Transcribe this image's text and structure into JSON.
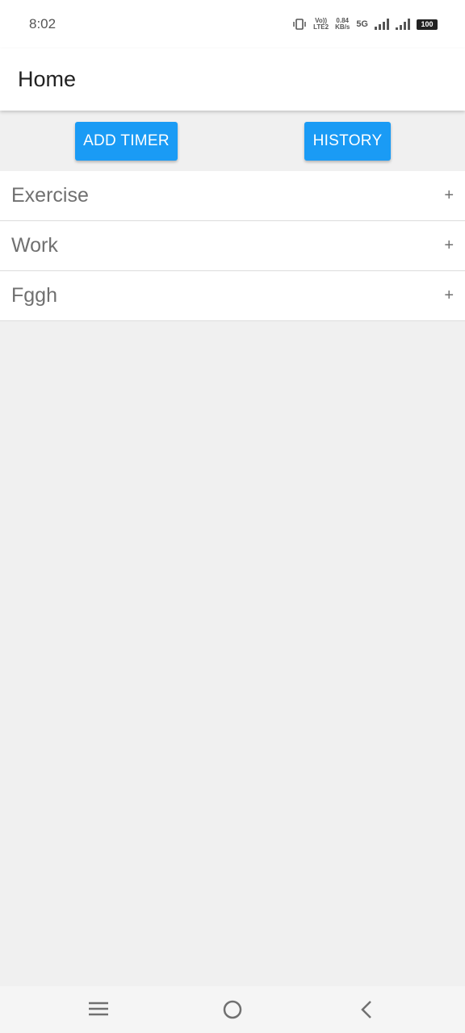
{
  "status_bar": {
    "time": "8:02",
    "volte": "Vo))",
    "lte": "LTE2",
    "net_speed_value": "0.84",
    "net_speed_unit": "KB/s",
    "network": "5G",
    "battery": "100"
  },
  "app_bar": {
    "title": "Home"
  },
  "buttons": {
    "add_timer": "ADD TIMER",
    "history": "HISTORY"
  },
  "timers": [
    {
      "label": "Exercise",
      "icon": "plus-icon"
    },
    {
      "label": "Work",
      "icon": "plus-icon"
    },
    {
      "label": "Fggh",
      "icon": "plus-icon"
    }
  ],
  "plus_symbol": "+",
  "colors": {
    "accent": "#1a9bf5",
    "background": "#f0f0f0",
    "surface": "#ffffff",
    "text_secondary": "#707070"
  },
  "nav_bar": {
    "icons": [
      "menu-icon",
      "home-icon",
      "back-icon"
    ]
  }
}
